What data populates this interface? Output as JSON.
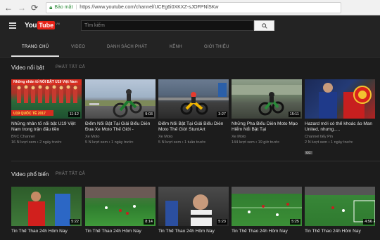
{
  "browser": {
    "secure_label": "Bảo mật",
    "separator": "|",
    "url": "https://www.youtube.com/channel/UCEg6i0XKXZ-sJOFPNlSKw"
  },
  "masthead": {
    "logo_you": "You",
    "logo_tube": "Tube",
    "logo_country": "VN",
    "search_placeholder": "Tìm kiếm"
  },
  "tabs": [
    {
      "label": "TRANG CHỦ",
      "active": true
    },
    {
      "label": "VIDEO",
      "active": false
    },
    {
      "label": "DANH SÁCH PHÁT",
      "active": false
    },
    {
      "label": "KÊNH",
      "active": false
    },
    {
      "label": "GIỚI THIỆU",
      "active": false
    }
  ],
  "featured": {
    "title": "Video nổi bật",
    "play_all": "PHÁT TẤT CẢ",
    "videos": [
      {
        "title": "Những nhân tố nổi bật U19 Việt Nam trong trận đấu tiền",
        "channel": "BVC Channel",
        "meta": "16 N lượt xem • 2 ngày trước",
        "duration": "11:12",
        "banner_top": "Những nhân tố NỔI BẬT U19 Việt Nam",
        "banner_bottom": "U19 QUỐC TẾ 2017"
      },
      {
        "title": "Điểm Nổi Bật Tại Giải Biểu Diễn Đua Xe Moto Thế Giới -",
        "channel": "Xe Moto",
        "meta": "5 N lượt xem • 1 ngày trước",
        "duration": "9:03"
      },
      {
        "title": "Điểm Nổi Bật Tại Giải Biểu Diễn Moto Thế Giới StuntArt",
        "channel": "Xe Moto",
        "meta": "5 N lượt xem • 1 tuần trước",
        "duration": "3:27"
      },
      {
        "title": "Những Pha Biểu Diễn Moto Mạo Hiểm Nổi Bật Tại",
        "channel": "Xe Moto",
        "meta": "144 lượt xem • 19 giờ trước",
        "duration": "15:11"
      },
      {
        "title": "Hazard mới có thể khoác áo Man United, nhưng.....",
        "channel": "Channel tiếy Pin",
        "meta": "2 N lượt xem • 1 ngày trước",
        "duration": "",
        "badge": "CC"
      }
    ]
  },
  "popular": {
    "title": "Video phổ biến",
    "play_all": "PHÁT TẤT CẢ",
    "videos": [
      {
        "title": "Tin Thể Thao 24h Hôm Nay",
        "duration": "5:22"
      },
      {
        "title": "Tin Thể Thao 24h Hôm Nay",
        "duration": "8:14"
      },
      {
        "title": "Tin Thể Thao 24h Hôm Nay",
        "duration": "5:23"
      },
      {
        "title": "Tin Thể Thao 24h Hôm Nay",
        "duration": "5:25"
      },
      {
        "title": "Tin Thể Thao 24h Hôm Nay",
        "duration": "4:56"
      }
    ]
  }
}
